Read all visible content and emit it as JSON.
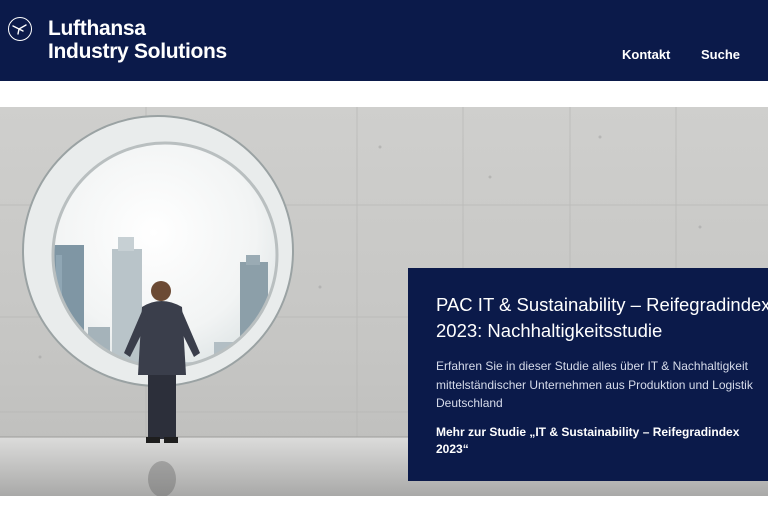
{
  "header": {
    "brand_line1": "Lufthansa",
    "brand_line2": "Industry Solutions",
    "logo_icon": "crane-icon",
    "nav": [
      {
        "label": "Kontakt"
      },
      {
        "label": "Suche"
      }
    ]
  },
  "hero": {
    "image": "businessman-at-round-window-city-view",
    "title_line1": "PAC IT & Sustainability – Reifegradindex",
    "title_line2": "2023: Nachhaltigkeitsstudie",
    "description": "Erfahren Sie in dieser Studie alles über IT & Nachhaltigkeit mittelständischer Unternehmen aus Produktion und Logistik Deutschland",
    "link_label": "Mehr zur Studie „IT & Sustainability – Reifegradindex 2023“"
  },
  "colors": {
    "brand_navy": "#0b1a4a",
    "panel_text": "#ffffff",
    "wall_grey": "#c8c8c6"
  }
}
